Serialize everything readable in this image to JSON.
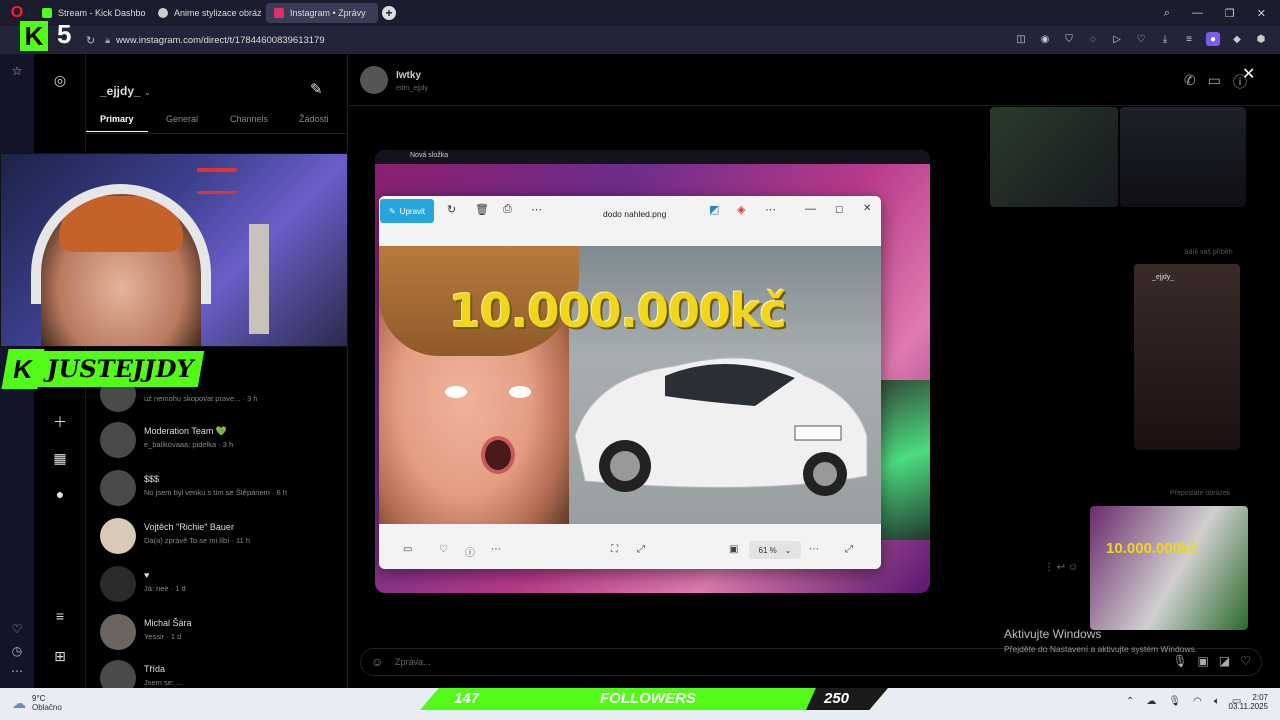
{
  "browser": {
    "tabs": [
      {
        "label": "Stream - Kick Dashboard",
        "color": "#53fc18"
      },
      {
        "label": "Anime stylizace obrázku",
        "color": "#cccccc"
      },
      {
        "label": "Instagram • Zprávy",
        "color": "#e1306c",
        "active": true
      }
    ],
    "url": "www.instagram.com/direct/t/17844600839613179"
  },
  "stream_overlay": {
    "logo_letter": "K",
    "logo_number": "5",
    "streamer_name": "JUSTEJJDY",
    "followers_count": "147",
    "followers_label": "FOLLOWERS",
    "followers_goal": "250",
    "followers_progress": 0.588
  },
  "instagram": {
    "username": "_ejjdy_",
    "tabs": [
      "Primary",
      "General",
      "Channels",
      "Žádosti"
    ],
    "conversations": [
      {
        "name": "",
        "preview": "už nemohu skopovat prave... · 3 h"
      },
      {
        "name": "Moderation Team 💚",
        "preview": "e_balikovaaa: pidelka · 3 h"
      },
      {
        "name": "$$$",
        "preview": "No jsem byl venku s tím se Štěpánem · 6 h"
      },
      {
        "name": "Vojtěch \"Richie\" Bauer",
        "preview": "Da(a) zprávě To se mi líbí · 11 h"
      },
      {
        "name": "♥",
        "preview": "Já: nee · 1 d"
      },
      {
        "name": "Michal Šára",
        "preview": "Yessir · 1 d"
      },
      {
        "name": "Třída",
        "preview": "Jsem se: ..."
      }
    ],
    "chat": {
      "contact_name": "Iwtky",
      "contact_sub": "edm_ejjdy",
      "shared_story_label": "Sdílí váš příběh",
      "forwarded_label": "Přeposláte obrázek",
      "thumb_text_1": "10.000.000kč",
      "story_username": "_ejjdy_",
      "message_placeholder": "Zpráva..."
    }
  },
  "image_viewer": {
    "folder": "Nová složka",
    "edit_label": "Upravit",
    "file_name": "dodo nahled.png",
    "overlay_text": "10.000.000kč",
    "zoom": "61 %"
  },
  "windows": {
    "activation_title": "Aktivujte Windows",
    "activation_sub": "Přejděte do Nastavení a aktivujte systém Windows.",
    "weather_temp": "9°C",
    "weather_desc": "Oblačno",
    "time": "2:07",
    "date": "03.11.2025"
  }
}
